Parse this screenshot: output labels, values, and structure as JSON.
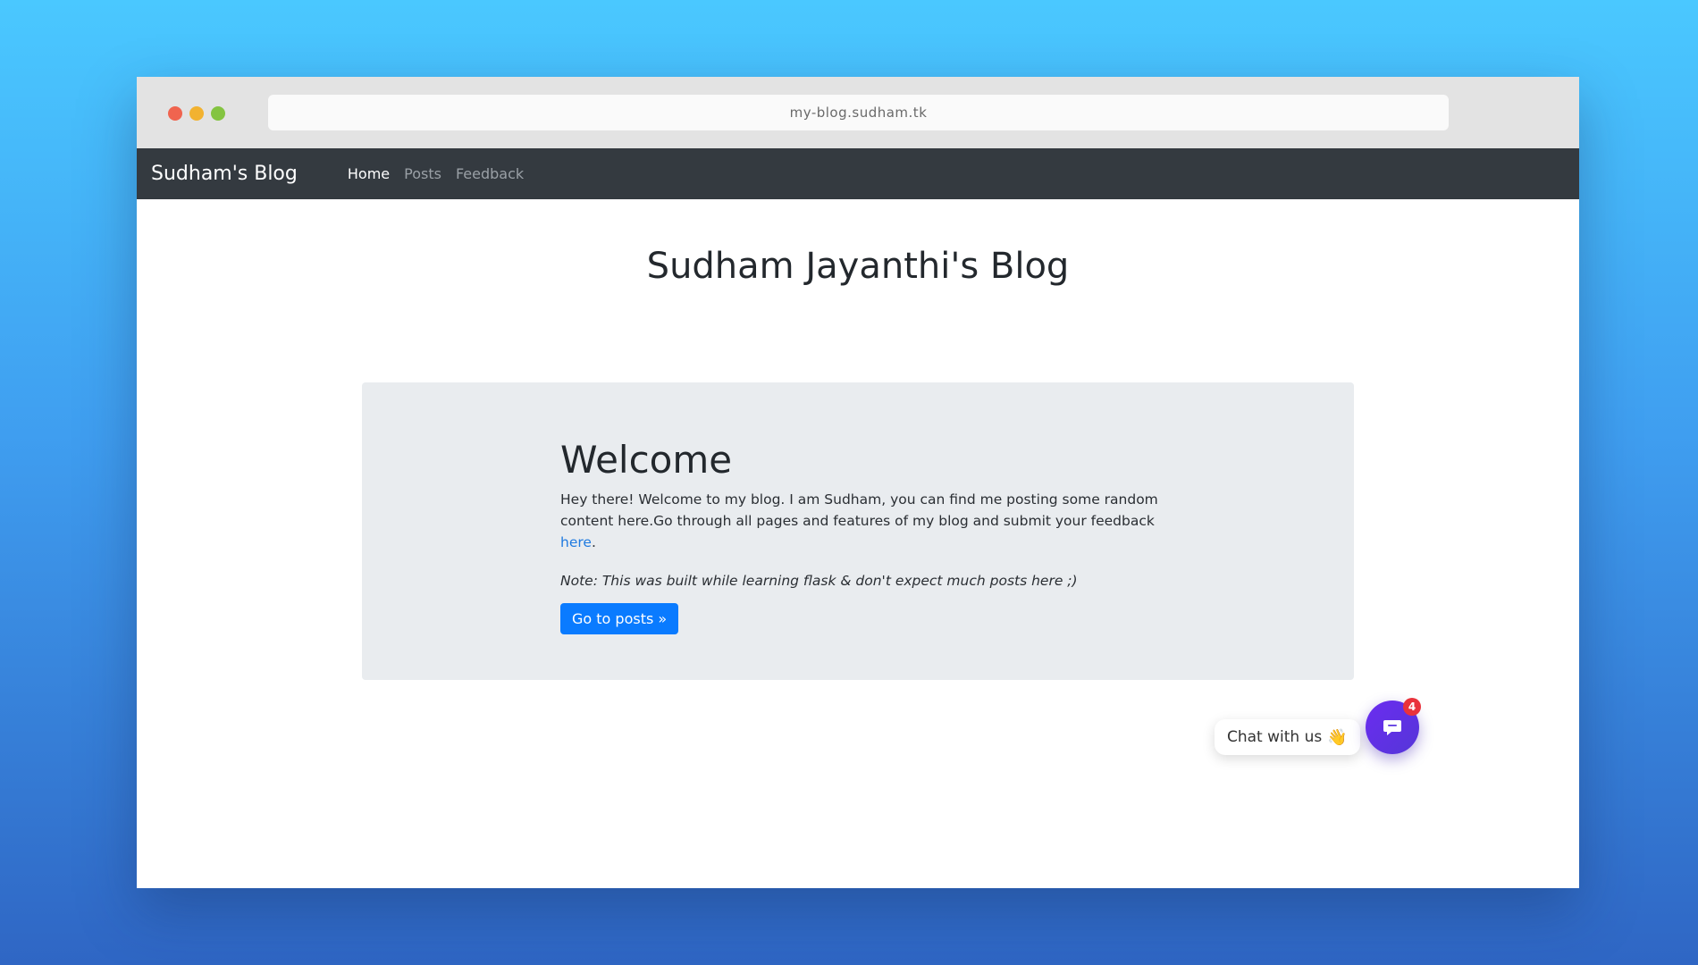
{
  "browser": {
    "url": "my-blog.sudham.tk"
  },
  "navbar": {
    "brand": "Sudham's Blog",
    "links": [
      {
        "label": "Home",
        "active": true
      },
      {
        "label": "Posts",
        "active": false
      },
      {
        "label": "Feedback",
        "active": false
      }
    ]
  },
  "page": {
    "title": "Sudham Jayanthi's Blog"
  },
  "jumbotron": {
    "heading": "Welcome",
    "lead_text": "Hey there! Welcome to my blog. I am Sudham, you can find me posting some random content here.Go through all pages and features of my blog and submit your feedback ",
    "lead_link": "here",
    "lead_end": ".",
    "note": "Note: This was built while learning flask & don't expect much posts here ;)",
    "button_label": "Go to posts »"
  },
  "chat": {
    "bubble_text": "Chat with us",
    "wave_icon": "👋",
    "badge_count": "4",
    "launcher_color": "#5a34e0"
  }
}
